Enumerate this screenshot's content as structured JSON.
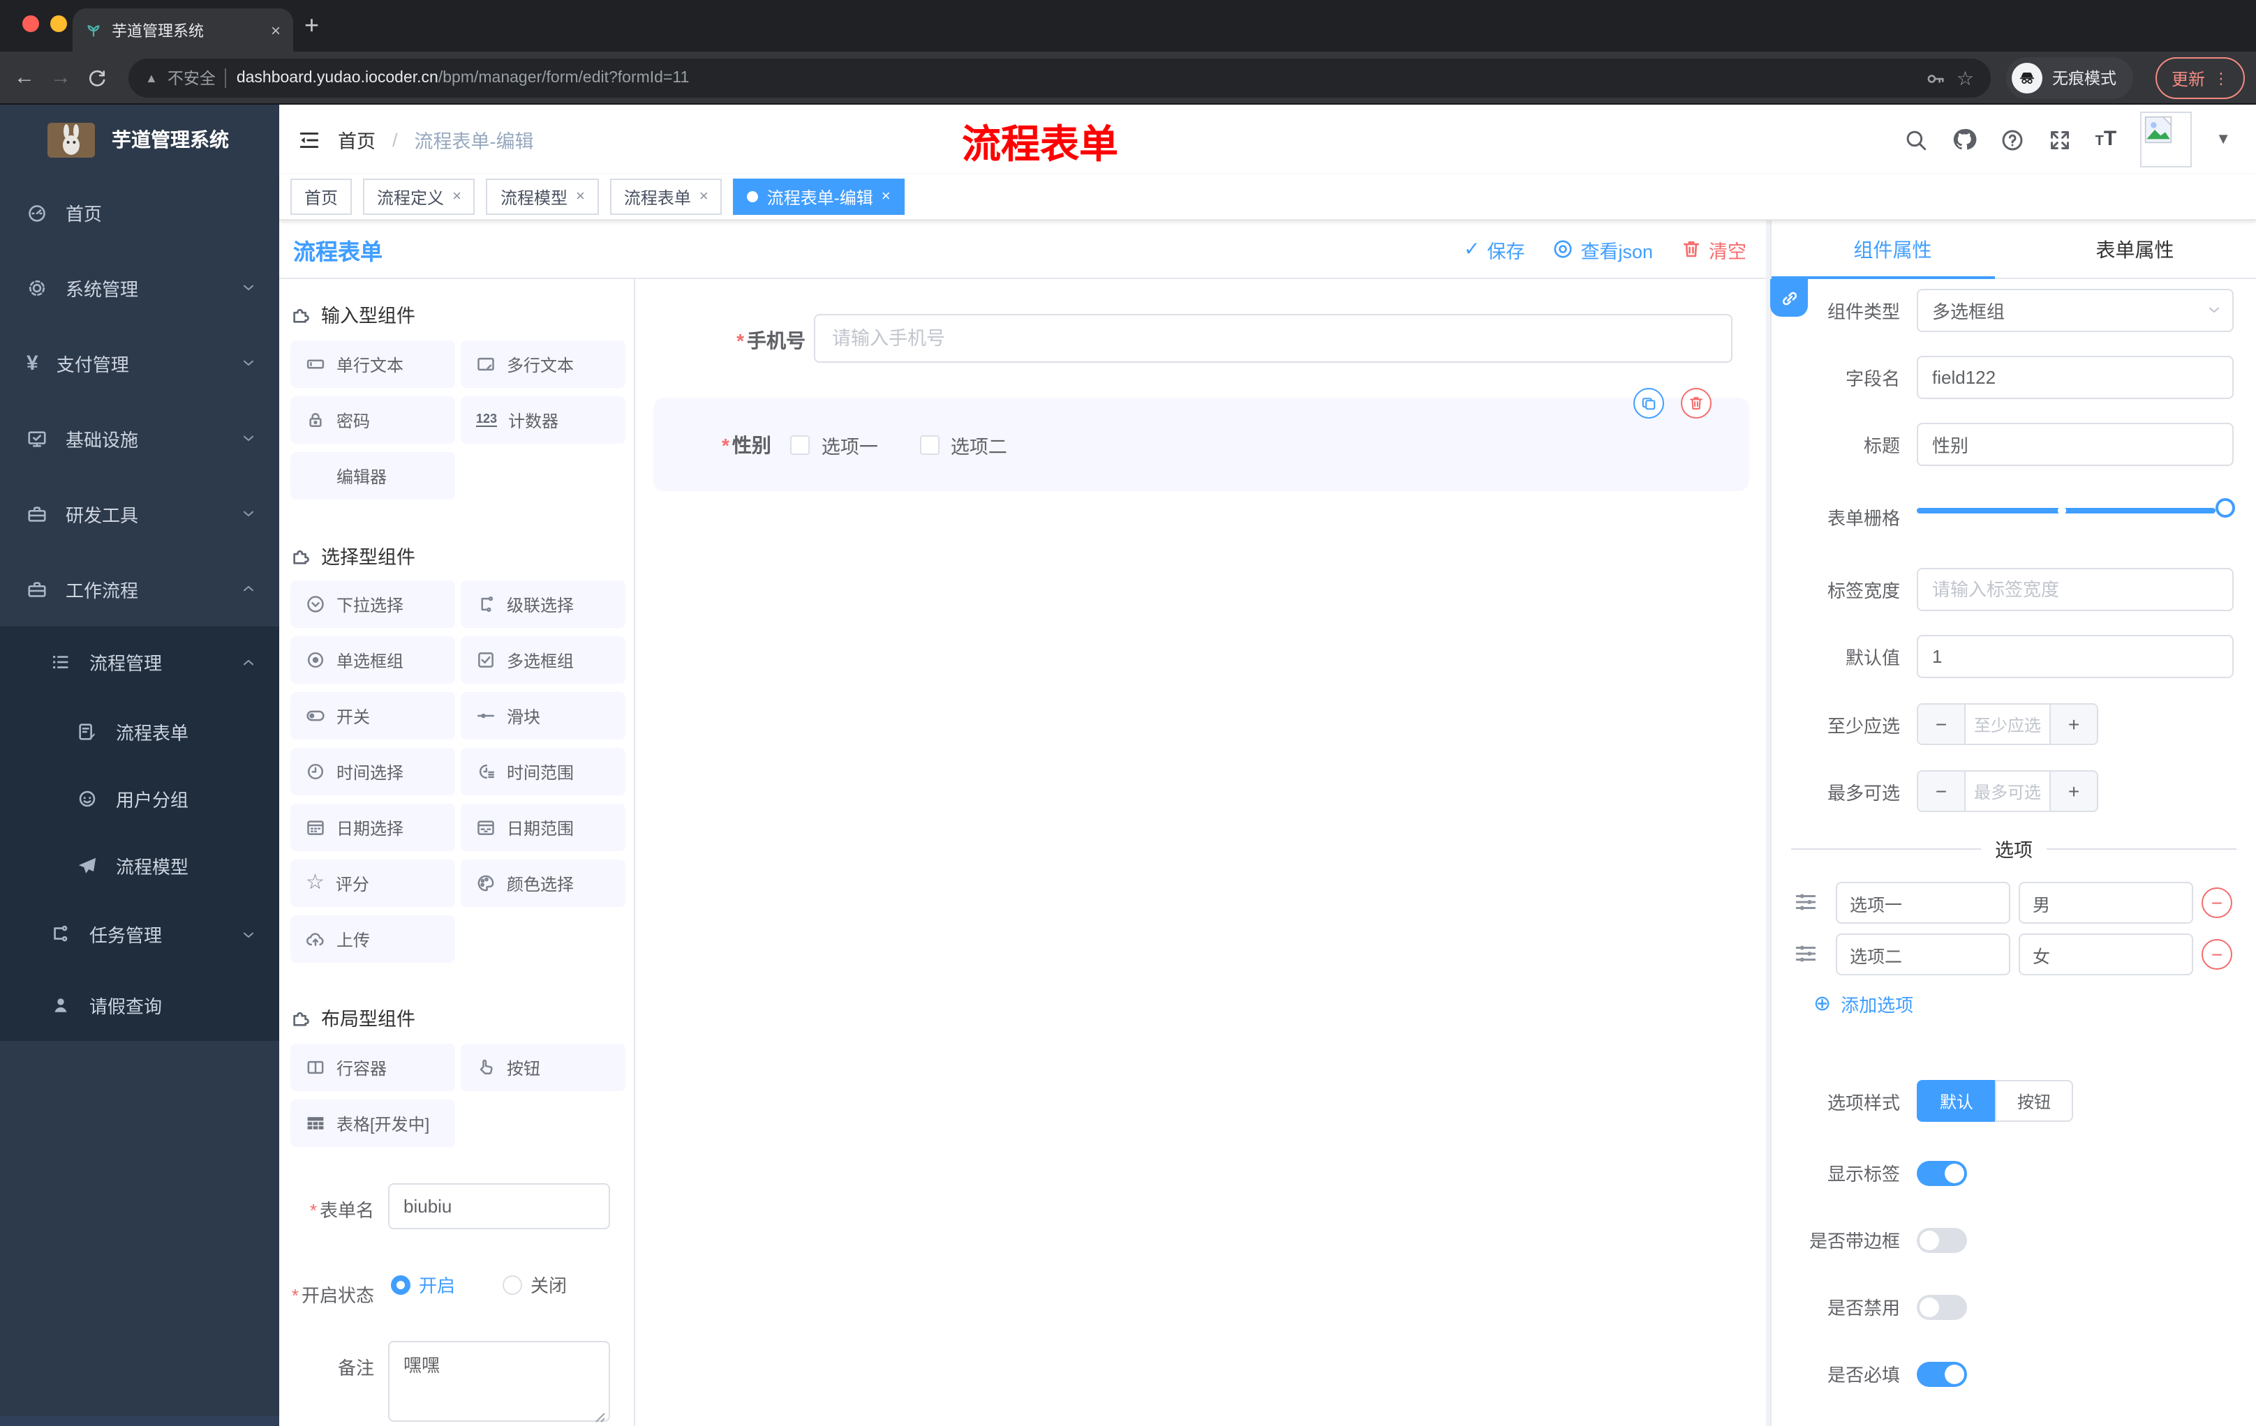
{
  "browser": {
    "tab_title": "芋道管理系统",
    "new_tab": "+",
    "close_tab": "×",
    "back": "←",
    "forward": "→",
    "security_label": "不安全",
    "url_host": "dashboard.yudao.iocoder.cn",
    "url_path": "/bpm/manager/form/edit?formId=11",
    "incognito_label": "无痕模式",
    "update_label": "更新"
  },
  "sidebar": {
    "logo_title": "芋道管理系统",
    "items": [
      {
        "label": "首页"
      },
      {
        "label": "系统管理"
      },
      {
        "label": "支付管理"
      },
      {
        "label": "基础设施"
      },
      {
        "label": "研发工具"
      },
      {
        "label": "工作流程"
      },
      {
        "label": "流程管理"
      },
      {
        "label": "流程表单"
      },
      {
        "label": "用户分组"
      },
      {
        "label": "流程模型"
      },
      {
        "label": "任务管理"
      },
      {
        "label": "请假查询"
      }
    ]
  },
  "header": {
    "breadcrumb_home": "首页",
    "breadcrumb_current": "流程表单-编辑",
    "watermark": "流程表单"
  },
  "tags": [
    {
      "label": "首页",
      "closable": false,
      "active": false
    },
    {
      "label": "流程定义",
      "closable": true,
      "active": false
    },
    {
      "label": "流程模型",
      "closable": true,
      "active": false
    },
    {
      "label": "流程表单",
      "closable": true,
      "active": false
    },
    {
      "label": "流程表单-编辑",
      "closable": true,
      "active": true
    }
  ],
  "designer": {
    "title": "流程表单",
    "save_label": "保存",
    "view_json_label": "查看json",
    "clear_label": "清空"
  },
  "components": {
    "input_group": {
      "title": "输入型组件",
      "items": [
        "单行文本",
        "多行文本",
        "密码",
        "计数器",
        "编辑器"
      ]
    },
    "select_group": {
      "title": "选择型组件",
      "items": [
        "下拉选择",
        "级联选择",
        "单选框组",
        "多选框组",
        "开关",
        "滑块",
        "时间选择",
        "时间范围",
        "日期选择",
        "日期范围",
        "评分",
        "颜色选择",
        "上传"
      ]
    },
    "layout_group": {
      "title": "布局型组件",
      "items": [
        "行容器",
        "按钮",
        "表格[开发中]"
      ]
    }
  },
  "form_meta": {
    "name_label": "表单名",
    "name_value": "biubiu",
    "status_label": "开启状态",
    "status_on": "开启",
    "status_off": "关闭",
    "remark_label": "备注",
    "remark_value": "嘿嘿"
  },
  "canvas": {
    "phone_label": "手机号",
    "phone_placeholder": "请输入手机号",
    "gender_label": "性别",
    "gender_options": [
      "选项一",
      "选项二"
    ]
  },
  "props": {
    "tabs": [
      "组件属性",
      "表单属性"
    ],
    "fields": {
      "type_label": "组件类型",
      "type_value": "多选框组",
      "field_label": "字段名",
      "field_value": "field122",
      "title_label": "标题",
      "title_value": "性别",
      "grid_label": "表单栅格",
      "label_width_label": "标签宽度",
      "label_width_placeholder": "请输入标签宽度",
      "default_label": "默认值",
      "default_value": "1",
      "min_label": "至少应选",
      "min_placeholder": "至少应选",
      "max_label": "最多可选",
      "max_placeholder": "最多可选"
    },
    "options_section": {
      "title": "选项",
      "rows": [
        {
          "label": "选项一",
          "value": "男"
        },
        {
          "label": "选项二",
          "value": "女"
        }
      ],
      "add_label": "添加选项"
    },
    "style_section": {
      "label": "选项样式",
      "options": [
        "默认",
        "按钮"
      ],
      "active": "默认"
    },
    "switches": [
      {
        "label": "显示标签",
        "on": true
      },
      {
        "label": "是否带边框",
        "on": false
      },
      {
        "label": "是否禁用",
        "on": false
      },
      {
        "label": "是否必填",
        "on": true
      }
    ]
  },
  "colors": {
    "accent": "#409eff",
    "danger": "#f56c6c",
    "watermark_red": "#ff0000",
    "sidebar_bg": "#2d3a4b",
    "submenu_bg": "#1f2d3d",
    "update_button": "#f28b82",
    "component_item_bg": "#f6f7ff"
  }
}
